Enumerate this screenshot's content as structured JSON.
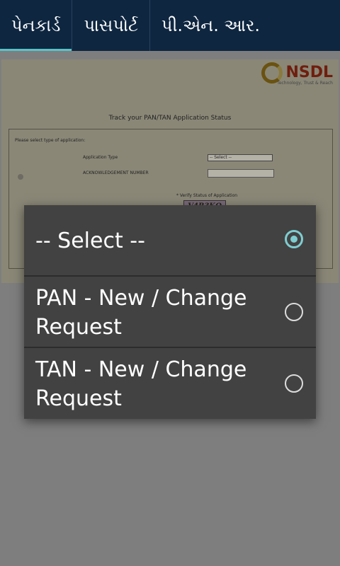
{
  "tabs": [
    {
      "label": "પેનકાર્ડ",
      "active": true
    },
    {
      "label": "પાસપોર્ટ",
      "active": false
    },
    {
      "label": "પી.એન. આર.",
      "active": false
    }
  ],
  "web": {
    "logo_text": "NSDL",
    "logo_tagline": "Technology, Trust & Reach",
    "heading": "Track your PAN/TAN Application Status",
    "form_hint": "Please select type of application:",
    "application_type_label": "Application Type",
    "select_value": "-- Select --",
    "ack_label": "ACKNOWLEDGEMENT NUMBER",
    "captcha_label": "* Verify Status of Application",
    "captcha_text": "V4R3KQ"
  },
  "dialog": {
    "options": [
      {
        "label": "-- Select --",
        "selected": true
      },
      {
        "label": "PAN - New / Change Request",
        "selected": false
      },
      {
        "label": "TAN - New / Change Request",
        "selected": false
      }
    ]
  },
  "colors": {
    "tabbar": "#0e2640",
    "tab_indicator": "#57c3c8",
    "dialog_bg": "#424242",
    "radio_accent": "#7fcdd0"
  }
}
